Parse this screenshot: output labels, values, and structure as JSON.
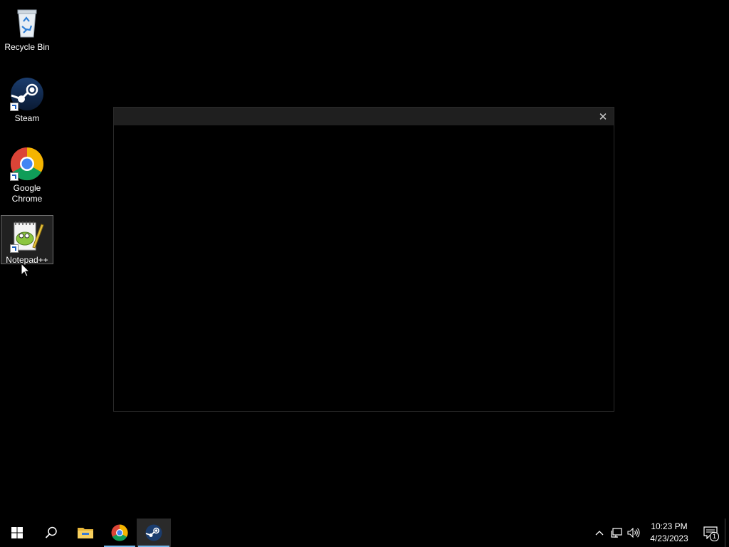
{
  "desktop": {
    "icons": [
      {
        "label": "Recycle Bin",
        "icon": "recycle-bin-icon"
      },
      {
        "label": "Steam",
        "icon": "steam-icon"
      },
      {
        "label": "Google Chrome",
        "icon": "chrome-icon"
      },
      {
        "label": "Notepad++",
        "icon": "notepad-plus-plus-icon"
      }
    ]
  },
  "dialog": {
    "title": "",
    "close_symbol": "✕"
  },
  "taskbar": {
    "buttons": [
      {
        "name": "start",
        "icon": "windows-logo-icon"
      },
      {
        "name": "search",
        "icon": "search-icon"
      },
      {
        "name": "file-explorer",
        "icon": "folder-icon"
      },
      {
        "name": "chrome",
        "icon": "chrome-icon",
        "running": true
      },
      {
        "name": "steam",
        "icon": "steam-icon",
        "running": true,
        "active": true
      }
    ],
    "tray": {
      "chevron": "^",
      "time": "10:23 PM",
      "date": "4/23/2023",
      "notification_count": "1"
    }
  },
  "colors": {
    "desktop_bg": "#000000",
    "dialog_titlebar": "#1f1f1f",
    "taskbar_accent": "#76b9ed"
  }
}
